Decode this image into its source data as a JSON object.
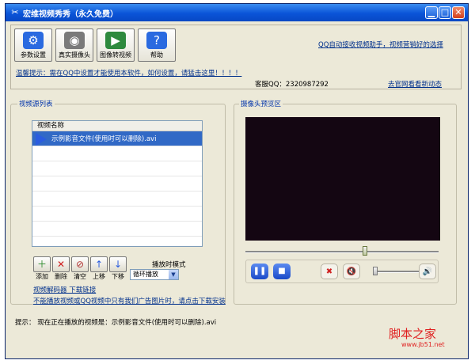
{
  "window": {
    "title": "宏维视频秀秀（永久免费）",
    "controls": {
      "minimize": "▁",
      "maximize": "□",
      "close": "✕"
    }
  },
  "toolbar": {
    "buttons": [
      {
        "label": "参数设置",
        "icon": "settings-icon"
      },
      {
        "label": "真实摄像头",
        "icon": "webcam-icon"
      },
      {
        "label": "图像转视频",
        "icon": "image-to-video-icon"
      },
      {
        "label": "帮助",
        "icon": "help-icon"
      }
    ],
    "top_link": "QQ自动接收视频助手，视频营销好的选择",
    "hint": "温馨提示：需在QQ中设置才能使用本软件，如何设置，请猛击这里！！！！",
    "qq_contact": "客服QQ：2320987292",
    "official_link": "去官网看看新动态"
  },
  "video_list": {
    "group_title": "视频源列表",
    "column_header": "视频名称",
    "rows": [
      "示例影音文件(使用时可以删除).avi"
    ],
    "buttons": [
      {
        "label": "添加",
        "icon": "add-icon"
      },
      {
        "label": "删除",
        "icon": "delete-icon"
      },
      {
        "label": "清空",
        "icon": "clear-icon"
      },
      {
        "label": "上移",
        "icon": "move-up-icon"
      },
      {
        "label": "下移",
        "icon": "move-down-icon"
      }
    ],
    "play_mode_label": "播放时模式",
    "play_mode_value": "循环播放",
    "decoder_link": "视频解码器 下载链接",
    "ad_link": "不能播放视频或QQ视频中只有我们广告图片时，请点击下载安装"
  },
  "preview": {
    "group_title": "摄像头预览区",
    "progress": 0.62,
    "volume": 0.0,
    "controls": [
      "pause-icon",
      "stop-icon",
      "clear-list-icon",
      "mute-icon",
      "volume-icon"
    ]
  },
  "status": {
    "text": "提示：  现在正在播放的视频是：示例影音文件(使用时可以删除).avi"
  },
  "watermark": {
    "logo": "脚本之家",
    "url": "www.jb51.net"
  },
  "colors": {
    "titlebar": "#0a54d8",
    "window_bg": "#ece9d8",
    "selection": "#3169c6",
    "link": "#00308c",
    "video_bg": "#140612",
    "watermark": "#e02020"
  }
}
